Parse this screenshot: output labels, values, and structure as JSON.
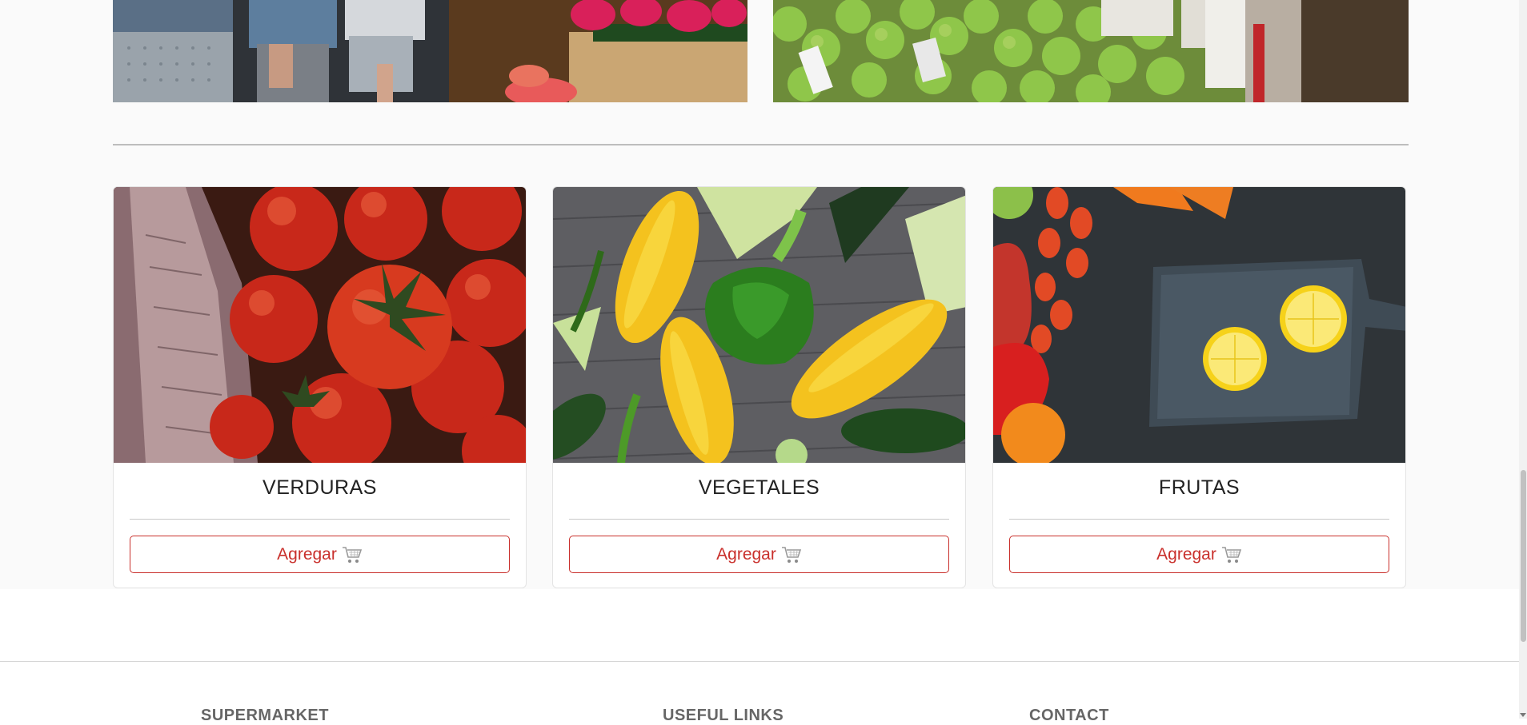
{
  "cards": [
    {
      "title": "VERDURAS",
      "button_label": "Agregar",
      "icon": "cart-icon"
    },
    {
      "title": "VEGETALES",
      "button_label": "Agregar",
      "icon": "cart-icon"
    },
    {
      "title": "FRUTAS",
      "button_label": "Agregar",
      "icon": "cart-icon"
    }
  ],
  "footer": {
    "col1": "SUPERMARKET",
    "col2": "USEFUL LINKS",
    "col3": "CONTACT"
  },
  "colors": {
    "accent": "#c9302c",
    "page_bg": "#fafafa"
  }
}
